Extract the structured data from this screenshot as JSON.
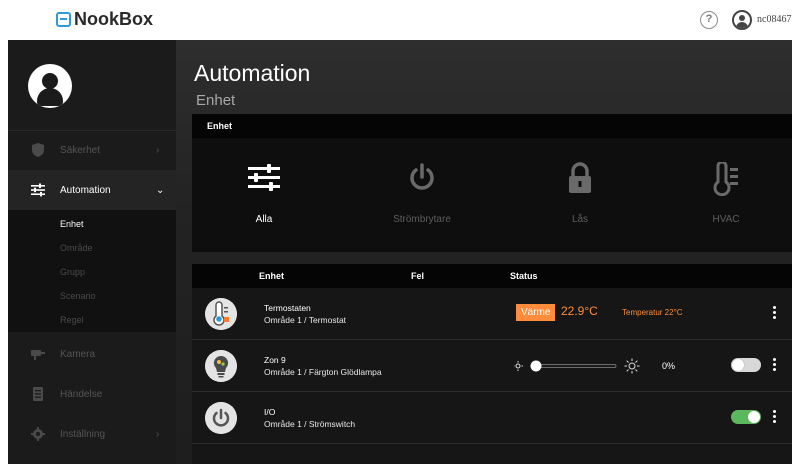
{
  "header": {
    "brand": "NookBox",
    "help_symbol": "?",
    "user_name": "nc08467"
  },
  "sidebar": {
    "items": [
      {
        "label": "Säkerhet",
        "icon": "shield-icon",
        "chevron": "›"
      },
      {
        "label": "Automation",
        "icon": "sliders-icon",
        "chevron": "⌄"
      },
      {
        "label": "Kamera",
        "icon": "camera-icon"
      },
      {
        "label": "Händelse",
        "icon": "list-icon"
      },
      {
        "label": "Inställning",
        "icon": "gear-icon",
        "chevron": "›"
      }
    ],
    "subitems": [
      "Enhet",
      "Område",
      "Grupp",
      "Scenario",
      "Regel"
    ]
  },
  "main": {
    "title": "Automation",
    "subtitle": "Enhet",
    "device_panel": {
      "header": "Enhet",
      "types": [
        {
          "label": "Alla",
          "icon": "sliders-icon"
        },
        {
          "label": "Strömbrytare",
          "icon": "power-icon"
        },
        {
          "label": "Lås",
          "icon": "lock-icon"
        },
        {
          "label": "HVAC",
          "icon": "thermometer-icon"
        }
      ]
    },
    "table": {
      "columns": [
        "Enhet",
        "Fel",
        "Status"
      ],
      "rows": [
        {
          "name": "Termostaten",
          "area": "Område 1 / Termostat",
          "mode": "Värme",
          "temp": "22.9°C",
          "setpoint": "Temperatur 22°C"
        },
        {
          "name": "Zon 9",
          "area": "Område 1 / Färgton Glödlampa",
          "percent": "0%",
          "level": 0,
          "on": false
        },
        {
          "name": "I/O",
          "area": "Område 1 / Strömswitch",
          "on": true
        }
      ]
    }
  },
  "colors": {
    "accent": "#ff8c3a",
    "brand": "#2e9bd6",
    "toggle_on": "#5cb85c"
  }
}
